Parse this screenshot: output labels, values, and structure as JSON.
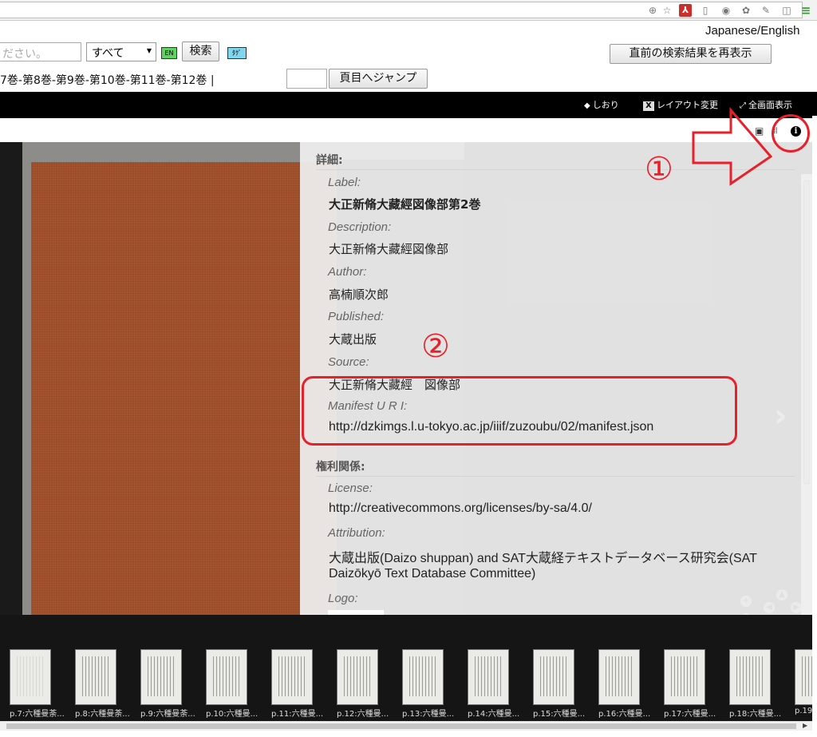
{
  "header": {
    "language_toggle": "Japanese/English",
    "search_placeholder": "ださい。",
    "scope_selected": "すべて",
    "en_badge": "EN",
    "search_button": "検索",
    "tag_badge": "ﾀｸﾞ",
    "redisplay_button": "直前の検索結果を再表示",
    "volume_links": "7巻-第8巻-第9巻-第10巻-第11巻-第12巻 |",
    "jump_button": "頁目へジャンプ"
  },
  "toolbar": {
    "bookmark": "しおり",
    "layout": "レイアウト変更",
    "fullscreen": "全画面表示"
  },
  "viewer": {
    "page_indicator": "■■■",
    "next_arrow": "›"
  },
  "info": {
    "details_title": "詳細:",
    "label_label": "Label:",
    "label_value": "大正新脩大藏經図像部第2巻",
    "description_label": "Description:",
    "description_value": "大正新脩大藏經図像部",
    "author_label": "Author:",
    "author_value": "高楠順次郎",
    "published_label": "Published:",
    "published_value": "大蔵出版",
    "source_label": "Source:",
    "source_value": "大正新脩大藏經　図像部",
    "manifest_label": "Manifest U R I:",
    "manifest_value": "http://dzkimgs.l.u-tokyo.ac.jp/iiif/zuzoubu/02/manifest.json",
    "rights_title": "権利関係:",
    "license_label": "License:",
    "license_value": "http://creativecommons.org/licenses/by-sa/4.0/",
    "attribution_label": "Attribution:",
    "attribution_line1": "大蔵出版(Daizo shuppan) and SAT大蔵経テキストデータベース研究会(SAT",
    "attribution_line2": "Daizōkyō Text Database Committee)",
    "logo_label": "Logo:"
  },
  "annotations": {
    "marker1": "①",
    "marker2": "②",
    "color": "#e8202a"
  },
  "thumbnails": [
    "p.7:六種曼荼...",
    "p.8:六種曼荼...",
    "p.9:六種曼荼...",
    "p.10:六種曼...",
    "p.11:六種曼...",
    "p.12:六種曼...",
    "p.13:六種曼...",
    "p.14:六種曼...",
    "p.15:六種曼...",
    "p.16:六種曼...",
    "p.17:六種曼...",
    "p.18:六種曼...",
    "p.19"
  ]
}
